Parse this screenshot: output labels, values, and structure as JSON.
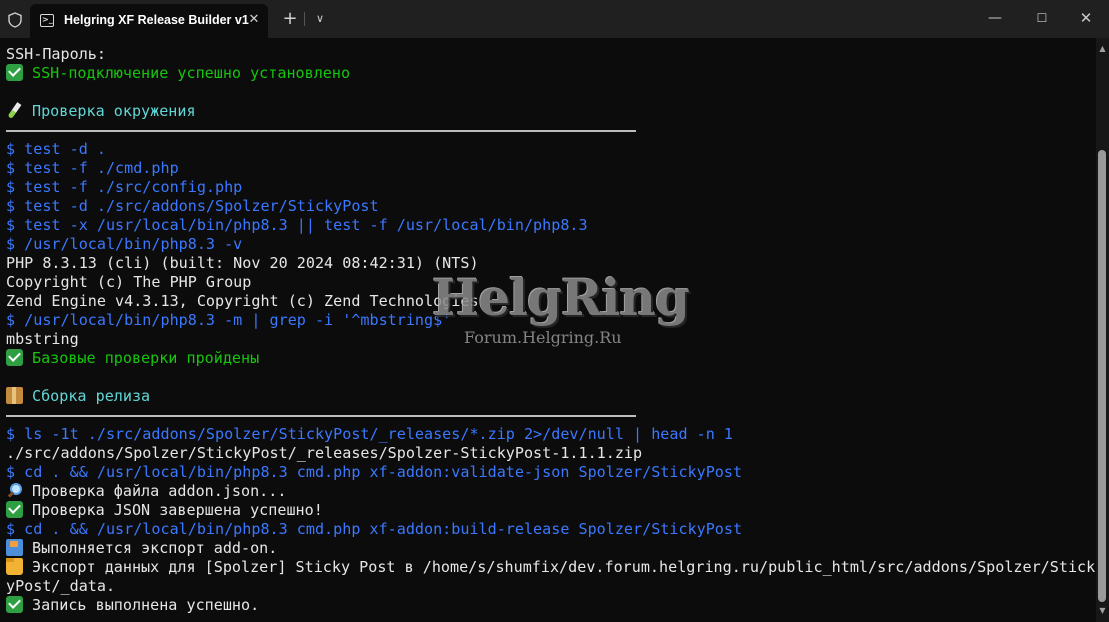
{
  "window": {
    "tab_title": "Helgring XF Release Builder v1",
    "tab_icon": "terminal-icon",
    "controls": {
      "minimize": "minimize-icon",
      "maximize": "maximize-icon",
      "close": "close-icon"
    }
  },
  "terminal": {
    "lines": [
      "SSH-Пароль:",
      "SSH-подключение успешно установлено",
      "",
      "Проверка окружения",
      "",
      "$ test -d .",
      "$ test -f ./cmd.php",
      "$ test -f ./src/config.php",
      "$ test -d ./src/addons/Spolzer/StickyPost",
      "$ test -x /usr/local/bin/php8.3 || test -f /usr/local/bin/php8.3",
      "$ /usr/local/bin/php8.3 -v",
      "PHP 8.3.13 (cli) (built: Nov 20 2024 08:42:31) (NTS)",
      "Copyright (c) The PHP Group",
      "Zend Engine v4.3.13, Copyright (c) Zend Technologies",
      "$ /usr/local/bin/php8.3 -m | grep -i '^mbstring$'",
      "mbstring",
      "Базовые проверки пройдены",
      "",
      "Сборка релиза",
      "",
      "$ ls -1t ./src/addons/Spolzer/StickyPost/_releases/*.zip 2>/dev/null | head -n 1",
      "./src/addons/Spolzer/StickyPost/_releases/Spolzer-StickyPost-1.1.1.zip",
      "$ cd . && /usr/local/bin/php8.3 cmd.php xf-addon:validate-json Spolzer/StickyPost",
      "Проверка файла addon.json...",
      "Проверка JSON завершена успешно!",
      "$ cd . && /usr/local/bin/php8.3 cmd.php xf-addon:build-release Spolzer/StickyPost",
      "Выполняется экспорт add-on.",
      "Экспорт данных для [Spolzer] Sticky Post в /home/s/shumfix/dev.forum.helgring.ru/public_html/src/addons/Spolzer/Stick",
      "yPost/_data.",
      "Запись выполнена успешно."
    ],
    "colors": {
      "background": "#0c0c0c",
      "text": "#e6e6e6",
      "success": "#16c60c",
      "command": "#3b78ff",
      "section": "#61d6d6"
    }
  },
  "watermark": {
    "logo": "HelgRing",
    "url": "Forum.Helgring.Ru"
  }
}
